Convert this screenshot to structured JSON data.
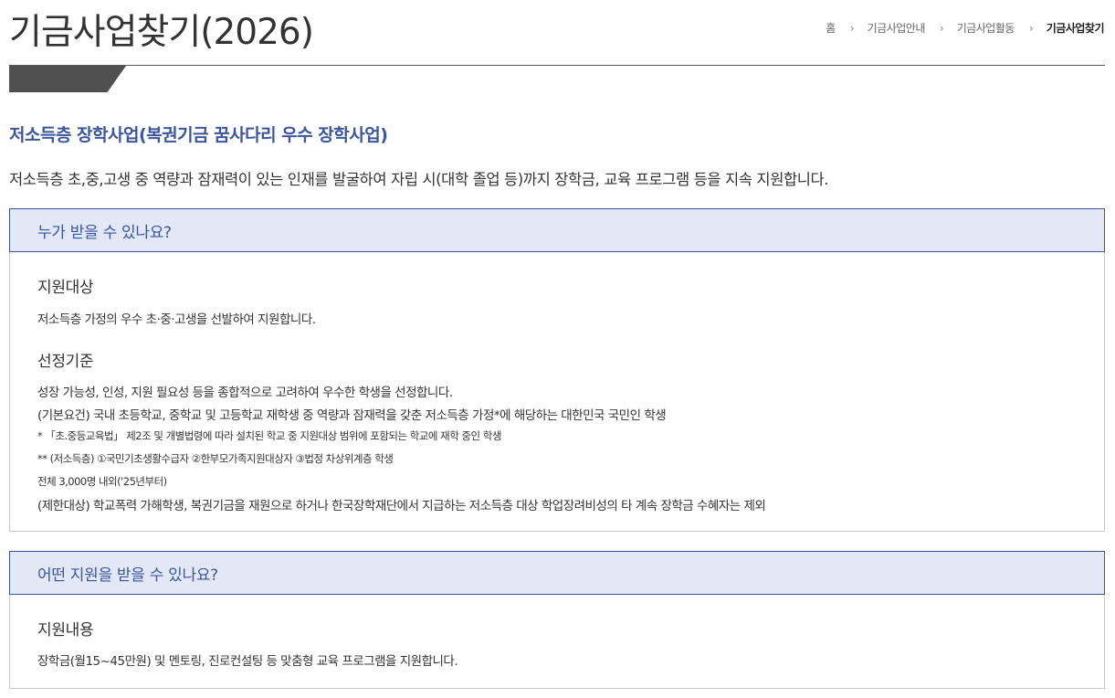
{
  "page": {
    "title": "기금사업찾기(2026)",
    "breadcrumb": [
      "홈",
      "기금사업안내",
      "기금사업활동",
      "기금사업찾기"
    ]
  },
  "program": {
    "title": "저소득층 장학사업(복권기금 꿈사다리 우수 장학사업)",
    "description": "저소득층 초,중,고생 중 역량과 잠재력이 있는 인재를 발굴하여 자립 시(대학 졸업 등)까지 장학금, 교육 프로그램 등을 지속 지원합니다."
  },
  "sections": [
    {
      "heading": "누가 받을 수 있나요?",
      "blocks": [
        {
          "title": "지원대상",
          "lines": [
            "저소득층 가정의 우수 초·중·고생을 선발하여 지원합니다."
          ]
        },
        {
          "title": "선정기준",
          "lines": [
            "성장 가능성, 인성, 지원 필요성 등을 종합적으로 고려하여 우수한 학생을 선정합니다.",
            "(기본요건) 국내 초등학교, 중학교 및 고등학교 재학생 중 역량과 잠재력을 갖춘 저소득층 가정*에 해당하는 대한민국 국민인 학생",
            "* 「초.중등교육법」 제2조 및 개별법령에 따라 설치된 학교 중 지원대상 범위에 포함되는 학교에 재학 중인 학생",
            "** (저소득층) ①국민기초생활수급자 ②한부모가족지원대상자 ③법정 차상위계층 학생",
            "전체 3,000명 내외('25년부터)",
            "(제한대상) 학교폭력 가해학생, 복권기금을 재원으로 하거나 한국장학재단에서 지급하는 저소득층 대상 학업장려비성의 타 계속 장학금 수혜자는 제외"
          ]
        }
      ]
    },
    {
      "heading": "어떤 지원을 받을 수 있나요?",
      "blocks": [
        {
          "title": "지원내용",
          "lines": [
            "장학금(월15~45만원) 및 멘토링, 진로컨설팅 등 맞춤형 교육 프로그램을 지원합니다."
          ]
        }
      ]
    }
  ],
  "colors": {
    "accent": "#3b55a0",
    "section_header_bg": "#e3e8f6",
    "title_tab": "#505050"
  }
}
